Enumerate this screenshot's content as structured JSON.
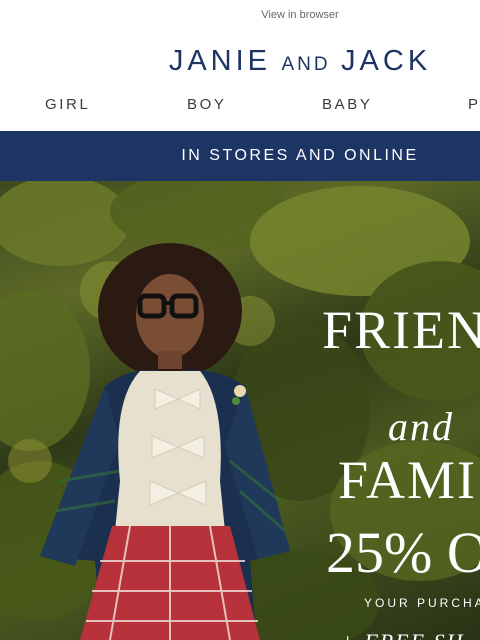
{
  "email": {
    "view_in_browser": "View in browser",
    "brand": {
      "part1": "JANIE",
      "part2": "AND",
      "part3": "JACK"
    },
    "nav": [
      "GIRL",
      "BOY",
      "BABY",
      "P"
    ],
    "banner": "IN STORES AND ONLINE",
    "hero": {
      "line1": "FRIEN",
      "line2": "and",
      "line3": "FAMI",
      "line4": "25% O",
      "line5": "YOUR PURCHA",
      "line6": "+ FREE SH"
    }
  }
}
